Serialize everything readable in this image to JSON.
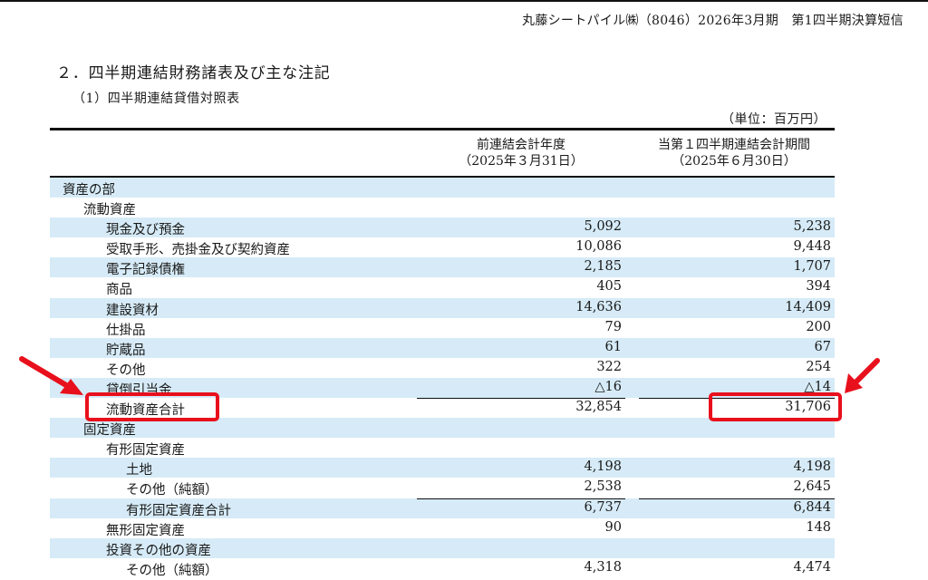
{
  "header": {
    "text": "丸藤シートパイル㈱（8046）2026年3月期　第1四半期決算短信"
  },
  "section_title": "２．四半期連結財務諸表及び主な注記",
  "section_subtitle": "（1）四半期連結貸借対照表",
  "unit_label": "（単位：百万円）",
  "columns": {
    "prev": {
      "line1": "前連結会計年度",
      "line2": "（2025年３月31日）"
    },
    "curr": {
      "line1": "当第１四半期連結会計期間",
      "line2": "（2025年６月30日）"
    }
  },
  "rows": [
    {
      "label": "資産の部",
      "prev": "",
      "curr": ""
    },
    {
      "label": "流動資産",
      "prev": "",
      "curr": ""
    },
    {
      "label": "現金及び預金",
      "prev": "5,092",
      "curr": "5,238"
    },
    {
      "label": "受取手形、売掛金及び契約資産",
      "prev": "10,086",
      "curr": "9,448"
    },
    {
      "label": "電子記録債権",
      "prev": "2,185",
      "curr": "1,707"
    },
    {
      "label": "商品",
      "prev": "405",
      "curr": "394"
    },
    {
      "label": "建設資材",
      "prev": "14,636",
      "curr": "14,409"
    },
    {
      "label": "仕掛品",
      "prev": "79",
      "curr": "200"
    },
    {
      "label": "貯蔵品",
      "prev": "61",
      "curr": "67"
    },
    {
      "label": "その他",
      "prev": "322",
      "curr": "254"
    },
    {
      "label": "貸倒引当金",
      "prev": "△16",
      "curr": "△14"
    },
    {
      "label": "流動資産合計",
      "prev": "32,854",
      "curr": "31,706"
    },
    {
      "label": "固定資産",
      "prev": "",
      "curr": ""
    },
    {
      "label": "有形固定資産",
      "prev": "",
      "curr": ""
    },
    {
      "label": "土地",
      "prev": "4,198",
      "curr": "4,198"
    },
    {
      "label": "その他（純額）",
      "prev": "2,538",
      "curr": "2,645"
    },
    {
      "label": "有形固定資産合計",
      "prev": "6,737",
      "curr": "6,844"
    },
    {
      "label": "無形固定資産",
      "prev": "90",
      "curr": "148"
    },
    {
      "label": "投資その他の資産",
      "prev": "",
      "curr": ""
    },
    {
      "label": "その他（純額）",
      "prev": "4,318",
      "curr": "4,474"
    }
  ],
  "colors": {
    "row_stripe": "#d6ebf7",
    "highlight": "#e8101c"
  }
}
